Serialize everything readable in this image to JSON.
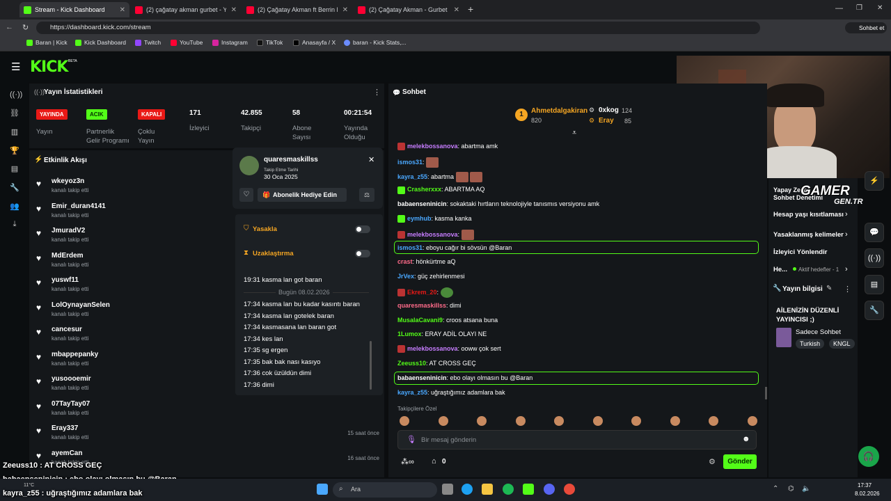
{
  "browser": {
    "tabs": [
      {
        "title": "Stream - Kick Dashboard",
        "active": true
      },
      {
        "title": "(2) çağatay akman gurbet - YouTube"
      },
      {
        "title": "(2) Çağatay Akman ft Berrin Keklik"
      },
      {
        "title": "(2) Çağatay Akman - Gurbet (Akustik)"
      }
    ],
    "url": "https://dashboard.kick.com/stream",
    "copilot": "Sohbet et",
    "bookmarks": [
      "Baran | Kick",
      "Kick Dashboard",
      "Twitch",
      "YouTube",
      "Instagram",
      "TikTok",
      "Anasayfa / X",
      "baran - Kick Stats,..."
    ]
  },
  "brand": {
    "logo": "KICK",
    "beta": "BETA",
    "accent": "#53fc18"
  },
  "stats": {
    "title": "Yayın İstatistikleri",
    "badges": [
      {
        "text": "YAYINDA",
        "label": "Yayın",
        "color": "#e91916"
      },
      {
        "text": "ACIK",
        "label": "Partnerlik Gelir Programı",
        "color": "#53fc18"
      },
      {
        "text": "KAPALI",
        "label": "Çoklu Yayın",
        "color": "#e91916"
      }
    ],
    "values": [
      {
        "value": "171",
        "label": "İzleyici"
      },
      {
        "value": "42.855",
        "label": "Takipçi"
      },
      {
        "value": "58",
        "label": "Abone Sayısı"
      },
      {
        "value": "00:21:54",
        "label": "Yayında Olduğu"
      }
    ]
  },
  "activity": {
    "title": "Etkinlik Akışı",
    "items": [
      {
        "name": "wkeyoz3n",
        "sub": "kanalı takip etti",
        "time": ""
      },
      {
        "name": "Emir_duran4141",
        "sub": "kanalı takip etti",
        "time": ""
      },
      {
        "name": "JmuradV2",
        "sub": "kanalı takip etti",
        "time": ""
      },
      {
        "name": "MdErdem",
        "sub": "kanalı takip etti",
        "time": ""
      },
      {
        "name": "yuswf11",
        "sub": "kanalı takip etti",
        "time": ""
      },
      {
        "name": "LolOynayanSelen",
        "sub": "kanalı takip etti",
        "time": ""
      },
      {
        "name": "cancesur",
        "sub": "kanalı takip etti",
        "time": ""
      },
      {
        "name": "mbappepanky",
        "sub": "kanalı takip etti",
        "time": ""
      },
      {
        "name": "yusoooemir",
        "sub": "kanalı takip etti",
        "time": ""
      },
      {
        "name": "07TayTay07",
        "sub": "kanalı takip etti",
        "time": ""
      },
      {
        "name": "Eray337",
        "sub": "kanalı takip etti",
        "time": "15 saat önce"
      },
      {
        "name": "ayemCan",
        "sub": "kanalı takip etti",
        "time": "16 saat önce"
      }
    ]
  },
  "usercard": {
    "username": "quaresmaskillss",
    "follow_label": "Takip Etme Tarihi",
    "follow_date": "30 Oca 2025",
    "gift_label": "Abonelik Hediye Edin",
    "ban_label": "Yasakla",
    "timeout_label": "Uzaklaştırma",
    "history": [
      "19:31 kasma lan got baran",
      "17:34 kasma lan bu kadar kasıntı baran",
      "17:34 kasma lan gotelek baran",
      "17:34 kasmasana lan baran got",
      "17:34 kes lan",
      "17:35 sg ergen",
      "17:35 bak bak nası kasıyo",
      "17:36 cok üzüldün dimi",
      "17:36 dimi"
    ],
    "divider": "Bugün 08.02.2026"
  },
  "chat": {
    "title": "Sohbet",
    "leaders": [
      {
        "rank": "1",
        "name": "Ahmetdalgakiran",
        "value": "820"
      },
      {
        "name": "0xkog",
        "value": "124"
      },
      {
        "name": "Eray",
        "value": "85"
      }
    ],
    "messages": [
      {
        "user": "melekbossanova",
        "color": "#c77dff",
        "text": ": abartma amk"
      },
      {
        "user": "ismos31",
        "color": "#4aa8ff",
        "text": ":"
      },
      {
        "user": "kayra_z55",
        "color": "#4aa8ff",
        "text": ": abartma"
      },
      {
        "user": "Crasherxxx",
        "color": "#53fc18",
        "text": ": ABARTMA AQ"
      },
      {
        "user": "babaenseninicin",
        "color": "#ffffff",
        "text": ": sokaktaki hırtların teknolojiyle tanısmıs versiyonu amk"
      },
      {
        "user": "eymhub",
        "color": "#4aa8ff",
        "text": ": kasma kanka"
      },
      {
        "user": "melekbossanova",
        "color": "#c77dff",
        "text": ":"
      },
      {
        "user": "ismos31",
        "color": "#4aa8ff",
        "text": ": eboyu cağır bi sövsün @Baran"
      },
      {
        "user": "crast",
        "color": "#ff6b8a",
        "text": ": hönkürtme aQ"
      },
      {
        "user": "JrVex",
        "color": "#4aa8ff",
        "text": ": güç zehirlenmesi"
      },
      {
        "user": "Ekrem_20",
        "color": "#e91916",
        "text": ":"
      },
      {
        "user": "quaresmaskillss",
        "color": "#ff6b8a",
        "text": ": dimi"
      },
      {
        "user": "MusalaCavani9",
        "color": "#53fc18",
        "text": ": croos atsana buna"
      },
      {
        "user": "1Lumox",
        "color": "#53fc18",
        "text": ": ERAY ADİL OLAYI NE"
      },
      {
        "user": "melekbossanova",
        "color": "#c77dff",
        "text": ": ooww çok sert"
      },
      {
        "user": "Zeeuss10",
        "color": "#53fc18",
        "text": ": AT CROSS GEÇ"
      },
      {
        "user": "babaenseninicin",
        "color": "#ffffff",
        "text": ": ebo olayı olmasın bu @Baran"
      },
      {
        "user": "kayra_z55",
        "color": "#4aa8ff",
        "text": ": uğraştığımız adamlara bak"
      }
    ],
    "followers_only": "Takipçilere Özel",
    "placeholder": "Bir mesaj gönderin",
    "points": "0",
    "send_label": "Gönder"
  },
  "rightpanel": {
    "menu": [
      "Yapay Zeka",
      "Sohbet Denetimi",
      "Hesap yaşı kısıtlaması",
      "Yasaklanmış kelimeler",
      "İzleyici Yönlendir",
      "He...",
      "Aktif hedefler - 1"
    ],
    "watermark": "GAMER GEN.TR",
    "stream_info_title": "Yayın bilgisi",
    "stream_title": "AİLENİZİN DÜZENLİ YAYINCISI ;)",
    "category": "Sadece Sohbet",
    "tags": [
      "Turkish",
      "KNGL"
    ]
  },
  "overlay": [
    "Zeeuss10 : AT CROSS GEÇ",
    "babaenseninicin : ebo olayı olmasın bu @Baran",
    "kayra_z55 : uğraştığımız adamlara bak"
  ],
  "taskbar": {
    "weather": "11°C",
    "search": "Ara",
    "time": "17:37",
    "date": "8.02.2026"
  }
}
